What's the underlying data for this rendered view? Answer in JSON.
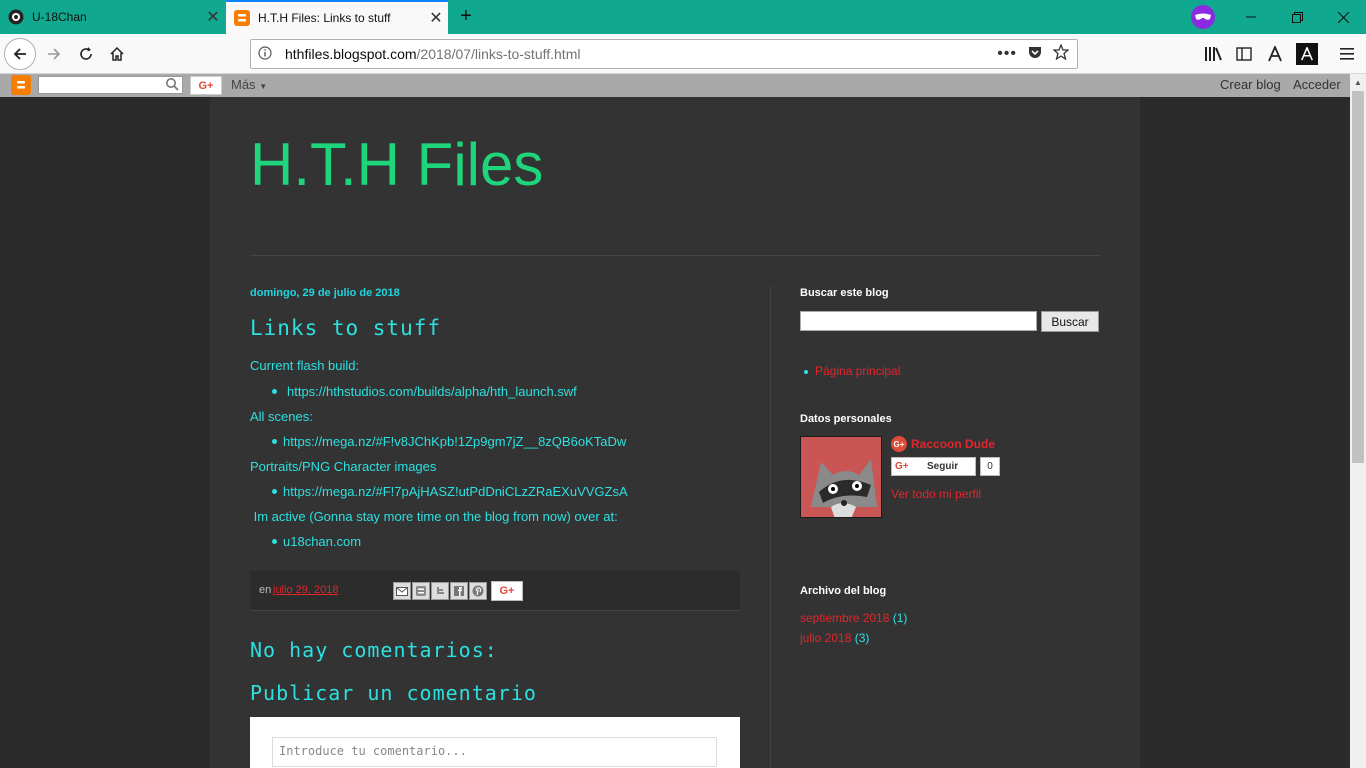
{
  "browser": {
    "tabs": [
      {
        "title": "U-18Chan",
        "active": false
      },
      {
        "title": "H.T.H Files: Links to stuff",
        "active": true
      }
    ],
    "url_host": "hthfiles.blogspot.com",
    "url_path": "/2018/07/links-to-stuff.html",
    "tab_close": "✕",
    "new_tab": "+"
  },
  "blogger_bar": {
    "more": "Más",
    "create_blog": "Crear blog",
    "sign_in": "Acceder",
    "gplus": "G+"
  },
  "blog": {
    "title": "H.T.H Files"
  },
  "post": {
    "date": "domingo, 29 de julio de 2018",
    "title": "Links to stuff",
    "sections": [
      {
        "heading": "Current flash build:",
        "link": "https://hthstudios.com/builds/alpha/hth_launch.swf"
      },
      {
        "heading": "All scenes:",
        "link": "https://mega.nz/#F!v8JChKpb!1Zp9gm7jZ__8zQB6oKTaDw"
      },
      {
        "heading": "Portraits/PNG Character images",
        "link": "https://mega.nz/#F!7pAjHASZ!utPdDniCLzZRaEXuVVGZsA"
      },
      {
        "heading": " Im active (Gonna stay more time on the blog from now) over at:",
        "link": "u18chan.com"
      }
    ],
    "footer_prefix": "en",
    "footer_date": "julio 29, 2018",
    "share_gplus": "G+"
  },
  "comments": {
    "none": "No hay comentarios:",
    "publish": "Publicar un comentario",
    "placeholder": "Introduce tu comentario..."
  },
  "sidebar": {
    "search_title": "Buscar este blog",
    "search_button": "Buscar",
    "home_link": "Página principal",
    "profile_title": "Datos personales",
    "profile_name": "Raccoon Dude",
    "follow_label": "Seguir",
    "follow_count": "0",
    "view_profile": "Ver todo mi perfil",
    "archive_title": "Archivo del blog",
    "archive": [
      {
        "label": "septiembre 2018",
        "count": "(1)"
      },
      {
        "label": "julio 2018",
        "count": "(3)"
      }
    ]
  },
  "colors": {
    "tabstrip": "#10a88e",
    "title_green": "#1fd57c",
    "cyan_text": "#2de0e0",
    "red_link": "#e0262d",
    "page_bg": "#333333"
  }
}
